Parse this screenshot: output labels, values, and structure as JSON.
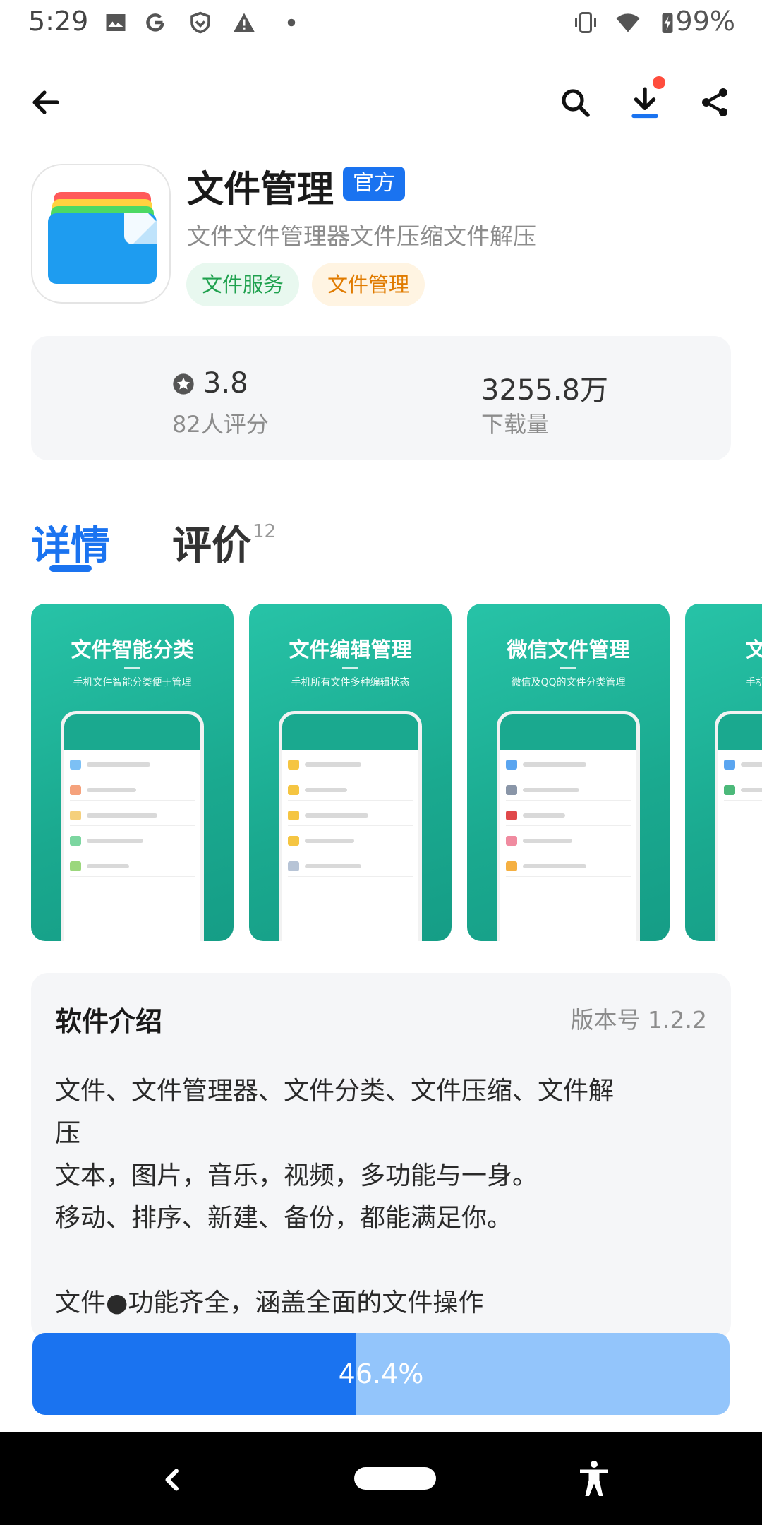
{
  "status_bar": {
    "time": "5:29",
    "battery": "99%"
  },
  "app": {
    "name": "文件管理",
    "badge": "官方",
    "subtitle": "文件文件管理器文件压缩文件解压",
    "tags": [
      "文件服务",
      "文件管理"
    ]
  },
  "stats": {
    "rating": "3.8",
    "rating_label": "82人评分",
    "downloads": "3255.8万",
    "downloads_label": "下载量"
  },
  "tabs": {
    "details": "详情",
    "reviews": "评价",
    "reviews_count": "12"
  },
  "screenshots": [
    {
      "title": "文件智能分类",
      "subtitle": "手机文件智能分类便于管理"
    },
    {
      "title": "文件编辑管理",
      "subtitle": "手机所有文件多种编辑状态"
    },
    {
      "title": "微信文件管理",
      "subtitle": "微信及QQ的文件分类管理"
    },
    {
      "title": "文档",
      "subtitle": "手机"
    }
  ],
  "intro": {
    "title": "软件介绍",
    "version": "版本号 1.2.2",
    "lines": [
      "文件、文件管理器、文件分类、文件压缩、文件解",
      "压",
      "文本，图片，音乐，视频，多功能与一身。",
      "移动、排序、新建、备份，都能满足你。",
      "",
      "文件●功能齐全，涵盖全面的文件操作"
    ]
  },
  "progress": {
    "value": 0.464,
    "label": "46.4%"
  },
  "colors": {
    "accent": "#1a73f0",
    "accent_light": "#93c5fb",
    "teal": "#1aa98f",
    "badge_dot": "#ff4d3d"
  },
  "icons": [
    "back-arrow-icon",
    "search-icon",
    "download-icon",
    "share-icon",
    "star-badge-icon",
    "nav-back-icon",
    "nav-home-pill",
    "accessibility-icon"
  ]
}
